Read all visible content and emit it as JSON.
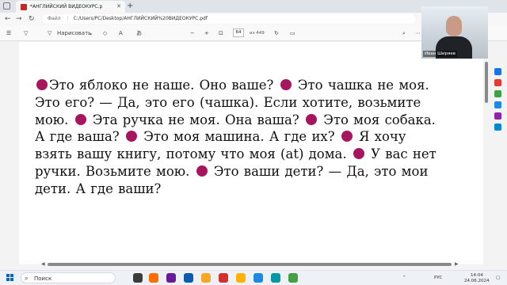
{
  "browser": {
    "tab_title": "*АНГЛИЙСКИЙ ВИДЕОКУРС.p",
    "tab_close": "✕",
    "new_tab": "+",
    "address_label": "Файл",
    "address_url": "C:/Users/PC/Desktop/АНГЛИЙСКИЙ%20ВИДЕОКУРС.pdf",
    "nav_back": "←",
    "nav_forward": "→",
    "nav_reload": "↻",
    "more": "⋯"
  },
  "pdf_toolbar": {
    "draw_label": "Нарисовать",
    "zoom_out": "−",
    "zoom_in": "+",
    "page_current": "64",
    "page_total": "из 449"
  },
  "document": {
    "segments": [
      {
        "dot": true
      },
      {
        "text": "Это яблоко не наше. Оно ваше? "
      },
      {
        "dot": true
      },
      {
        "text": " Это чашка не моя. Это его? — Да, это его (чашка). Если хотите, возьмите мою. "
      },
      {
        "dot": true
      },
      {
        "text": " Эта ручка не моя. Она ваша? "
      },
      {
        "dot": true
      },
      {
        "text": " Это моя собака. А где ваша? "
      },
      {
        "dot": true
      },
      {
        "text": " Это моя машина. А где их? "
      },
      {
        "dot": true
      },
      {
        "text": " Я хочу взять вашу книгу, потому что моя (at) дома. "
      },
      {
        "dot": true
      },
      {
        "text": " У вас нет ручки. Возьмите мою. "
      },
      {
        "dot": true
      },
      {
        "text": "  Это ваши дети? — Да, это мои дети. А где ваши?"
      }
    ],
    "dot_color": "#a8155f"
  },
  "webcam": {
    "name": "Иван Ширяев"
  },
  "taskbar": {
    "search_placeholder": "Поиск",
    "lang": "РУС",
    "time": "14:04",
    "date": "24.06.2024"
  }
}
